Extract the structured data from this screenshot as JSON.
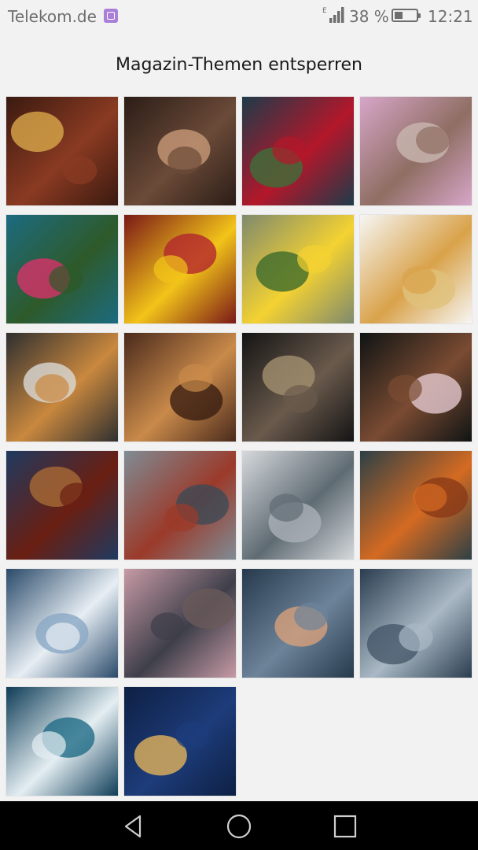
{
  "status_bar": {
    "carrier": "Telekom.de",
    "notification_icon": "gallery-icon",
    "network_type": "E",
    "battery_percent_text": "38 %",
    "battery_level": 0.38,
    "time": "12:21"
  },
  "header": {
    "title": "Magazin-Themen entsperren"
  },
  "themes": [
    {
      "icon": "golf-clubs-image",
      "colors": [
        "#3a1a10",
        "#8a3a22",
        "#d9a74a"
      ]
    },
    {
      "icon": "tea-set-image",
      "colors": [
        "#2b1d17",
        "#6b4a38",
        "#c89a78"
      ]
    },
    {
      "icon": "red-flowers-image",
      "colors": [
        "#1e3b4a",
        "#b3172a",
        "#3c6f3a"
      ]
    },
    {
      "icon": "peony-image",
      "colors": [
        "#d7a6c9",
        "#8f6e63",
        "#c9b7b0"
      ]
    },
    {
      "icon": "roses-image",
      "colors": [
        "#1c6b80",
        "#2e5a2a",
        "#d8326a"
      ]
    },
    {
      "icon": "fruit-bowl-image",
      "colors": [
        "#7a1818",
        "#f2c419",
        "#b3262d"
      ]
    },
    {
      "icon": "daffodils-image",
      "colors": [
        "#7f8a6d",
        "#f4d232",
        "#3c6a2c"
      ]
    },
    {
      "icon": "waffles-image",
      "colors": [
        "#f6f6f4",
        "#d9a24a",
        "#e0c27c"
      ]
    },
    {
      "icon": "spices-image",
      "colors": [
        "#2f2f30",
        "#c9883e",
        "#d9d9d6"
      ]
    },
    {
      "icon": "chess-image",
      "colors": [
        "#4a2a1c",
        "#c98a4a",
        "#3a1e12"
      ]
    },
    {
      "icon": "chair-image",
      "colors": [
        "#141414",
        "#6a5a4c",
        "#a2906f"
      ]
    },
    {
      "icon": "blossom-image",
      "colors": [
        "#0f1414",
        "#7a4b32",
        "#e3c8cf"
      ]
    },
    {
      "icon": "tea-glass-image",
      "colors": [
        "#1f3a60",
        "#6a1f12",
        "#a86a36"
      ]
    },
    {
      "icon": "brick-building-image",
      "colors": [
        "#7f8c95",
        "#9b3a2a",
        "#3c4a55"
      ]
    },
    {
      "icon": "bridge-image",
      "colors": [
        "#d6d9dc",
        "#5f6b73",
        "#aab0b6"
      ]
    },
    {
      "icon": "autumn-leaves-image",
      "colors": [
        "#2d4046",
        "#d46a22",
        "#8a3a16"
      ]
    },
    {
      "icon": "frost-image",
      "colors": [
        "#2a4a6a",
        "#e7eef4",
        "#8aa8c4"
      ]
    },
    {
      "icon": "sea-pier-image",
      "colors": [
        "#c69aa5",
        "#3e3f4a",
        "#6a5a5a"
      ]
    },
    {
      "icon": "cloudy-sky-image",
      "colors": [
        "#273a4d",
        "#6d8399",
        "#d7a07a"
      ]
    },
    {
      "icon": "dark-clouds-image",
      "colors": [
        "#2b3d50",
        "#a9b8c4",
        "#46586a"
      ]
    },
    {
      "icon": "ocean-wave-image",
      "colors": [
        "#0f3d58",
        "#e4eef2",
        "#1f6c86"
      ]
    },
    {
      "icon": "mont-saint-michel-image",
      "colors": [
        "#0e2044",
        "#1d3c7a",
        "#e2b35a"
      ]
    }
  ],
  "nav": {
    "back": "back-icon",
    "home": "home-icon",
    "recents": "recents-icon"
  }
}
